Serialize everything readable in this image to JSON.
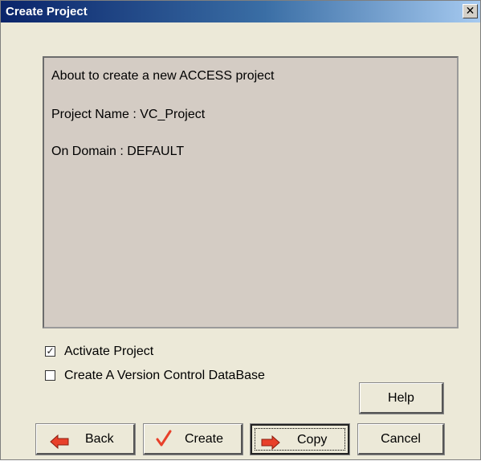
{
  "window": {
    "title": "Create Project",
    "close_glyph": "✕"
  },
  "message": {
    "line1": "About to create a new ACCESS project",
    "line2": "Project Name : VC_Project",
    "line3": "On Domain : DEFAULT"
  },
  "options": {
    "activate_project": {
      "label": "Activate Project",
      "checked": true,
      "mark": "✓"
    },
    "create_vc_db": {
      "label": "Create A Version Control DataBase",
      "checked": false,
      "mark": ""
    }
  },
  "buttons": {
    "help": "Help",
    "back": "Back",
    "create": "Create",
    "copy": "Copy",
    "cancel": "Cancel"
  },
  "icons": {
    "back": "arrow-left-icon",
    "create": "checkmark-icon",
    "copy": "arrow-right-icon",
    "accent": "#e8402a"
  }
}
